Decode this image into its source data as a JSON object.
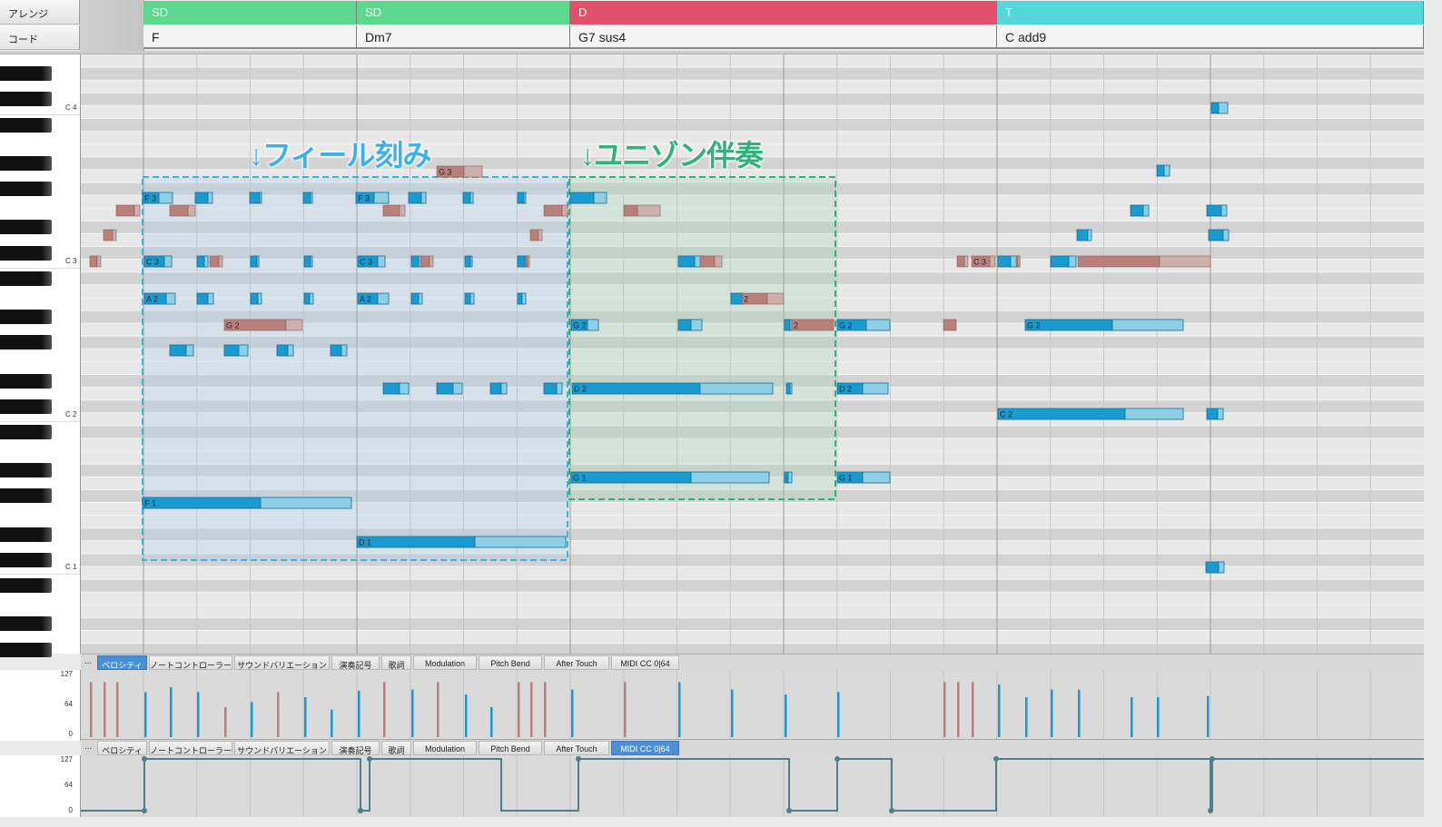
{
  "header": {
    "arrange_label": "アレンジ",
    "chord_label": "コード",
    "sections": [
      {
        "label": "SD",
        "color": "#5ed78f"
      },
      {
        "label": "SD",
        "color": "#5ed78f"
      },
      {
        "label": "D",
        "color": "#e0506a"
      },
      {
        "label": "T",
        "color": "#53d7d9"
      }
    ],
    "chords": [
      "F",
      "Dm7",
      "G7 sus4",
      "C add9"
    ]
  },
  "keyboard": {
    "octave_labels": [
      "C 4",
      "C 3",
      "C 2",
      "C 1"
    ]
  },
  "annotations": {
    "fill_title": "↓フィール刻み",
    "fill_color": "#3db0e6",
    "unison_title": "↓ユニゾン伴奏",
    "unison_color": "#2eb37a"
  },
  "note_labels": [
    "F 3",
    "C 3",
    "A 2",
    "G 2",
    "F 1",
    "G 3",
    "F 3",
    "C 3",
    "A 2",
    "D 1",
    "G 2",
    "D 2",
    "G 1",
    "2",
    "2",
    "G 2",
    "D 2",
    "G 1",
    "C 3",
    "G 2",
    "C 2"
  ],
  "velocity_panel": {
    "more": "...",
    "tabs": [
      "ベロシティ",
      "ノートコントローラー",
      "サウンドバリエーション",
      "演奏記号",
      "歌詞",
      "Modulation",
      "Pitch Bend",
      "After Touch",
      "MIDI CC 0|64"
    ],
    "active_tab": 0,
    "axis": [
      "127",
      "64",
      "0"
    ]
  },
  "cc_panel": {
    "more": "...",
    "tabs": [
      "ベロシティ",
      "ノートコントローラー",
      "サウンドバリエーション",
      "演奏記号",
      "歌詞",
      "Modulation",
      "Pitch Bend",
      "After Touch",
      "MIDI CC 0|64"
    ],
    "active_tab": 8,
    "axis": [
      "127",
      "64",
      "0"
    ]
  },
  "colors": {
    "note_active": "#1a9bd0",
    "note_tail": "#8fcfe6",
    "note_ghost": "#b97f7a",
    "velocity_bar": "#1a9bd0",
    "cc_line": "#4d7f8e"
  }
}
